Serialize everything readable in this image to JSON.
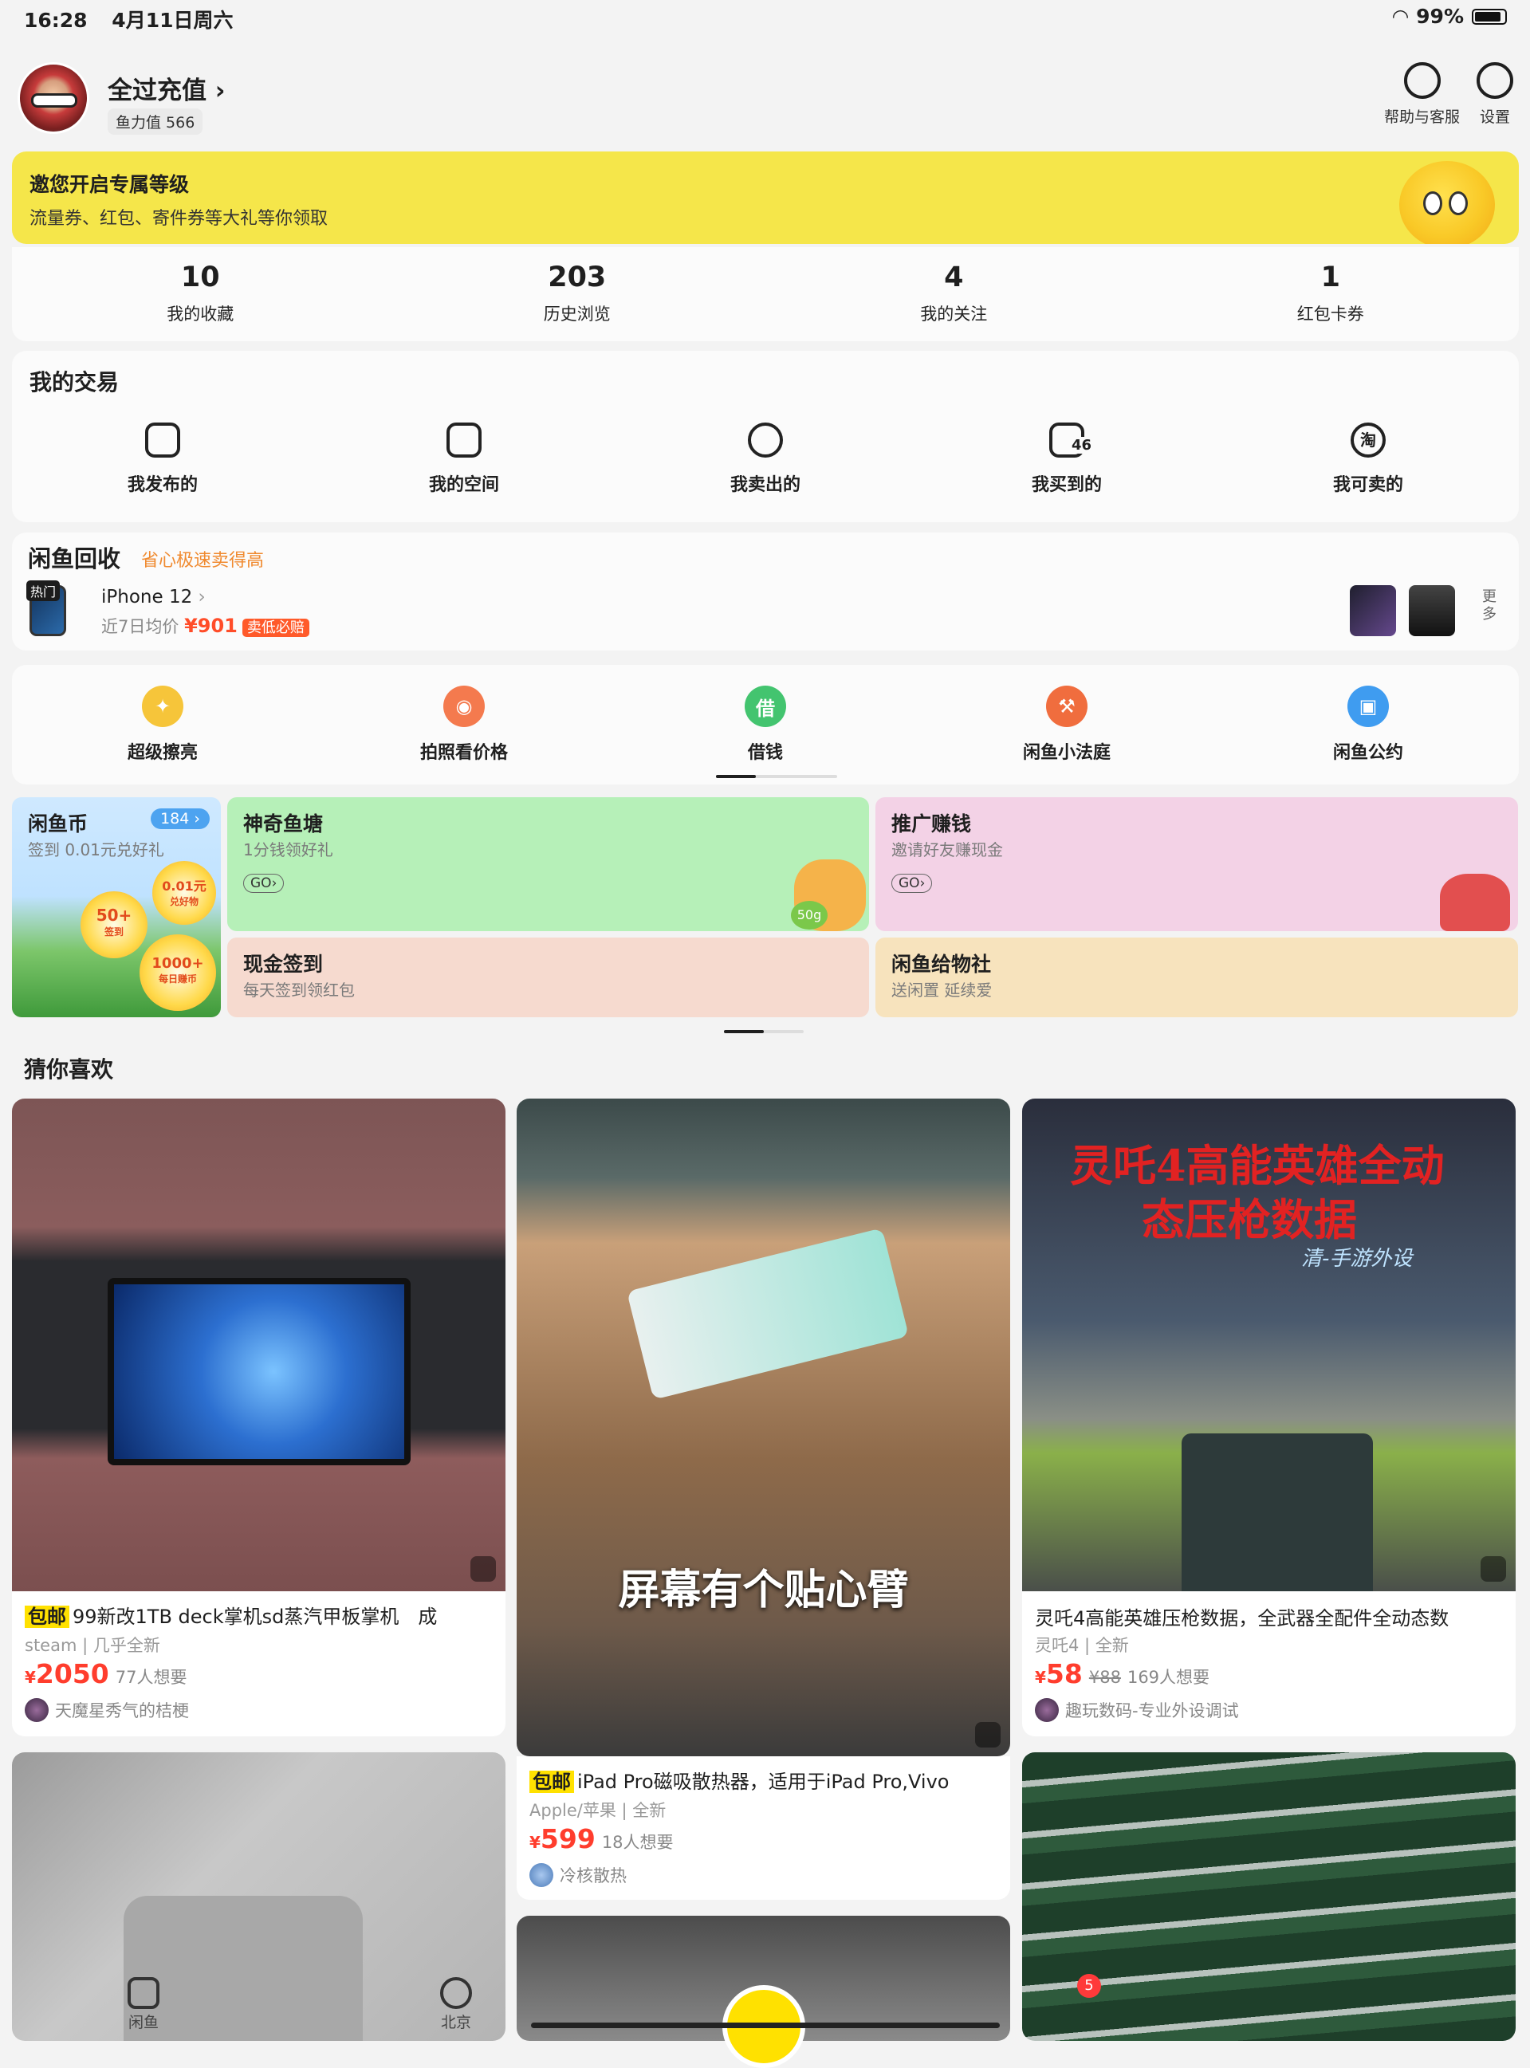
{
  "status": {
    "time": "16:28",
    "date": "4月11日周六",
    "battery": "99%"
  },
  "profile": {
    "name": "全过充值",
    "chevron": "›",
    "score": "鱼力值 566"
  },
  "header_actions": [
    {
      "label": "帮助与客服",
      "icon": "help-icon"
    },
    {
      "label": "设置",
      "icon": "settings-icon"
    }
  ],
  "banner": {
    "title": "邀您开启专属等级",
    "subtitle": "流量券、红包、寄件券等大礼等你领取",
    "bg": "#f5e64a"
  },
  "stats": [
    {
      "value": "10",
      "label": "我的收藏"
    },
    {
      "value": "203",
      "label": "历史浏览"
    },
    {
      "value": "4",
      "label": "我的关注"
    },
    {
      "value": "1",
      "label": "红包卡券"
    }
  ],
  "trades": {
    "title": "我的交易",
    "items": [
      {
        "label": "我发布的",
        "icon": "published-icon"
      },
      {
        "label": "我的空间",
        "icon": "space-icon"
      },
      {
        "label": "我卖出的",
        "icon": "sold-icon"
      },
      {
        "label": "我买到的",
        "icon": "bought-icon",
        "count": "46"
      },
      {
        "label": "我可卖的",
        "icon": "sellable-icon",
        "glyph": "淘"
      }
    ]
  },
  "recycle": {
    "title": "闲鱼回收",
    "slogan": "省心极速卖得高",
    "hot_tag": "热门",
    "model": "iPhone 12",
    "chevron": "›",
    "avg_label": "近7日均价",
    "currency": "¥",
    "avg_price": "901",
    "guarantee": "卖低必赔",
    "more_top": "更",
    "more_bottom": "多"
  },
  "tools": [
    {
      "label": "超级擦亮",
      "color": "#f6c53a",
      "glyph": "✦"
    },
    {
      "label": "拍照看价格",
      "color": "#f47a4e",
      "glyph": "◉"
    },
    {
      "label": "借钱",
      "color": "#43c46f",
      "glyph": "借"
    },
    {
      "label": "闲鱼小法庭",
      "color": "#f06d3e",
      "glyph": "⚒"
    },
    {
      "label": "闲鱼公约",
      "color": "#3f9cf0",
      "glyph": "▣"
    }
  ],
  "tiles": {
    "coin": {
      "title": "闲鱼币",
      "sub": "签到 0.01元兑好礼",
      "badge": "184",
      "chevron": "›",
      "c1a": "50+",
      "c1b": "签到",
      "c2a": "0.01元",
      "c2b": "兑好物",
      "c3a": "1000+",
      "c3b": "每日赚币"
    },
    "pond": {
      "title": "神奇鱼塘",
      "sub": "1分钱领好礼",
      "go": "GO",
      "chevron": "›",
      "tag": "50g",
      "bg": "#b6f0b8"
    },
    "promote": {
      "title": "推广赚钱",
      "sub": "邀请好友赚现金",
      "go": "GO",
      "chevron": "›",
      "bg": "#f3d2e6"
    },
    "checkin": {
      "title": "现金签到",
      "sub": "每天签到领红包",
      "bg": "#f6dacf"
    },
    "charity": {
      "title": "闲鱼给物社",
      "sub": "送闲置 延续爱",
      "bg": "#f7e3bd"
    }
  },
  "guess": {
    "title": "猜你喜欢"
  },
  "products": [
    {
      "free": "包邮",
      "title": "99新改1TB deck掌机sd蒸汽甲板掌机　成",
      "brand": "steam",
      "condition": "几乎全新",
      "currency": "¥",
      "price": "2050",
      "want": "77人想要",
      "seller": "天魔星秀气的桔梗"
    },
    {
      "free": "",
      "title": "屏幕有个贴心臂",
      "caption": "屏幕有个贴心臂"
    },
    {
      "free": "",
      "title": "灵吒4高能英雄压枪数据，全武器全配件全动态数",
      "brand": "灵吒4",
      "condition": "全新",
      "currency": "¥",
      "price": "58",
      "old": "¥88",
      "want": "169人想要",
      "seller": "趣玩数码-专业外设调试",
      "overlay1": "灵吒4高能英雄全动",
      "overlay2": "态压枪数据",
      "overlay3": "清-手游外设"
    },
    {
      "free": "包邮",
      "title": "iPad Pro磁吸散热器，适用于iPad Pro,Vivo",
      "brand": "Apple/苹果",
      "condition": "全新",
      "currency": "¥",
      "price": "599",
      "want": "18人想要",
      "seller": "冷核散热"
    }
  ],
  "tabbar": {
    "home": "闲鱼",
    "location": "北京",
    "messages_badge": "5"
  }
}
